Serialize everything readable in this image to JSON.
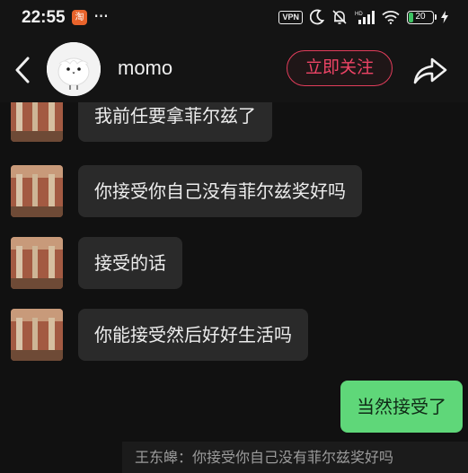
{
  "status_bar": {
    "time": "22:55",
    "app_badge": "淘",
    "more": "···",
    "vpn": "VPN",
    "battery": "20",
    "battery_level": 0.2
  },
  "header": {
    "contact_name": "momo",
    "follow_label": "立即关注"
  },
  "messages": [
    {
      "direction": "incoming",
      "text": "我前任要拿菲尔兹了"
    },
    {
      "direction": "incoming",
      "text": "你接受你自己没有菲尔兹奖好吗"
    },
    {
      "direction": "incoming",
      "text": "接受的话"
    },
    {
      "direction": "incoming",
      "text": "你能接受然后好好生活吗"
    },
    {
      "direction": "outgoing",
      "text": "当然接受了"
    }
  ],
  "quote": {
    "text": "王东皞：你接受你自己没有菲尔兹奖好吗"
  },
  "colors": {
    "background": "#111111",
    "incoming_bubble": "#2a2a2a",
    "outgoing_bubble": "#5fd779",
    "follow_accent": "#e23d5b"
  },
  "icons": {
    "back": "chevron-left-icon",
    "share": "share-arrow-icon",
    "moon": "moon-icon",
    "mute": "bell-off-icon",
    "signal": "signal-icon",
    "wifi": "wifi-icon",
    "charging": "bolt-icon"
  }
}
